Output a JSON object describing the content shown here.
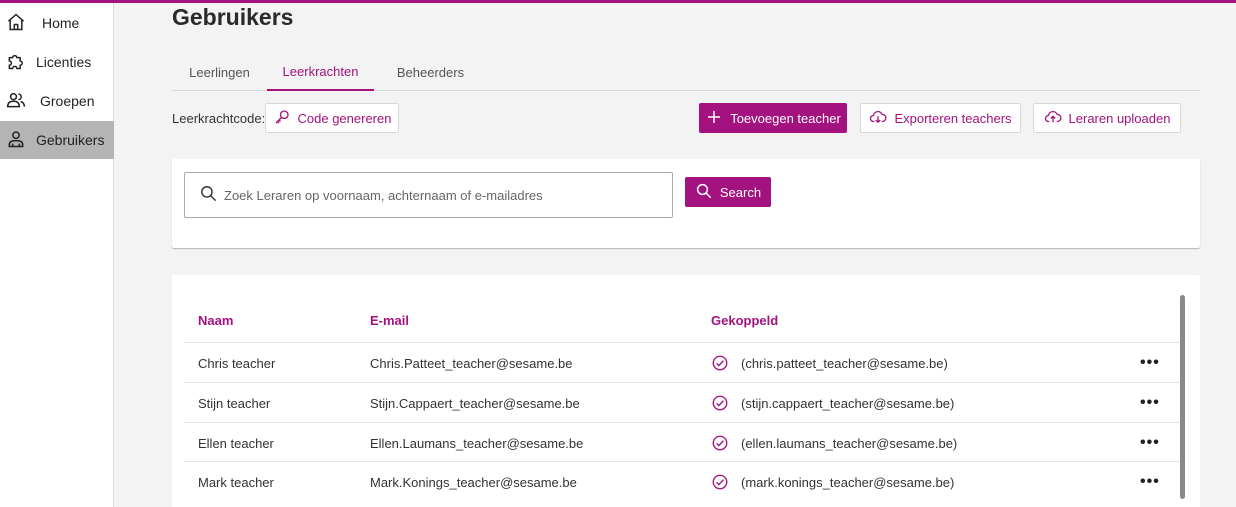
{
  "colors": {
    "accent": "#a3127f",
    "sidebar_active": "#b4b4b4"
  },
  "sidebar": {
    "items": [
      {
        "label": "Home",
        "icon": "home-icon"
      },
      {
        "label": "Licenties",
        "icon": "puzzle-icon"
      },
      {
        "label": "Groepen",
        "icon": "group-icon"
      },
      {
        "label": "Gebruikers",
        "icon": "user-icon",
        "active": true
      }
    ]
  },
  "page": {
    "title": "Gebruikers"
  },
  "tabs": [
    {
      "label": "Leerlingen"
    },
    {
      "label": "Leerkrachten",
      "active": true
    },
    {
      "label": "Beheerders"
    }
  ],
  "toolbar": {
    "code_label": "Leerkrachtcode:",
    "generate_code": "Code genereren",
    "add_teacher": "Toevoegen teacher",
    "export_teachers": "Exporteren teachers",
    "upload_teachers": "Leraren uploaden"
  },
  "search": {
    "placeholder": "Zoek Leraren op voornaam, achternaam of e-mailadres",
    "value": "",
    "button": "Search"
  },
  "table": {
    "headers": {
      "name": "Naam",
      "email": "E-mail",
      "linked": "Gekoppeld"
    },
    "rows": [
      {
        "name": "Chris teacher",
        "email": "Chris.Patteet_teacher@sesame.be",
        "linked": "(chris.patteet_teacher@sesame.be)",
        "actions": "•••"
      },
      {
        "name": "Stijn teacher",
        "email": "Stijn.Cappaert_teacher@sesame.be",
        "linked": "(stijn.cappaert_teacher@sesame.be)",
        "actions": "•••"
      },
      {
        "name": "Ellen teacher",
        "email": "Ellen.Laumans_teacher@sesame.be",
        "linked": "(ellen.laumans_teacher@sesame.be)",
        "actions": "•••"
      },
      {
        "name": "Mark teacher",
        "email": "Mark.Konings_teacher@sesame.be",
        "linked": "(mark.konings_teacher@sesame.be)",
        "actions": "•••"
      }
    ]
  }
}
